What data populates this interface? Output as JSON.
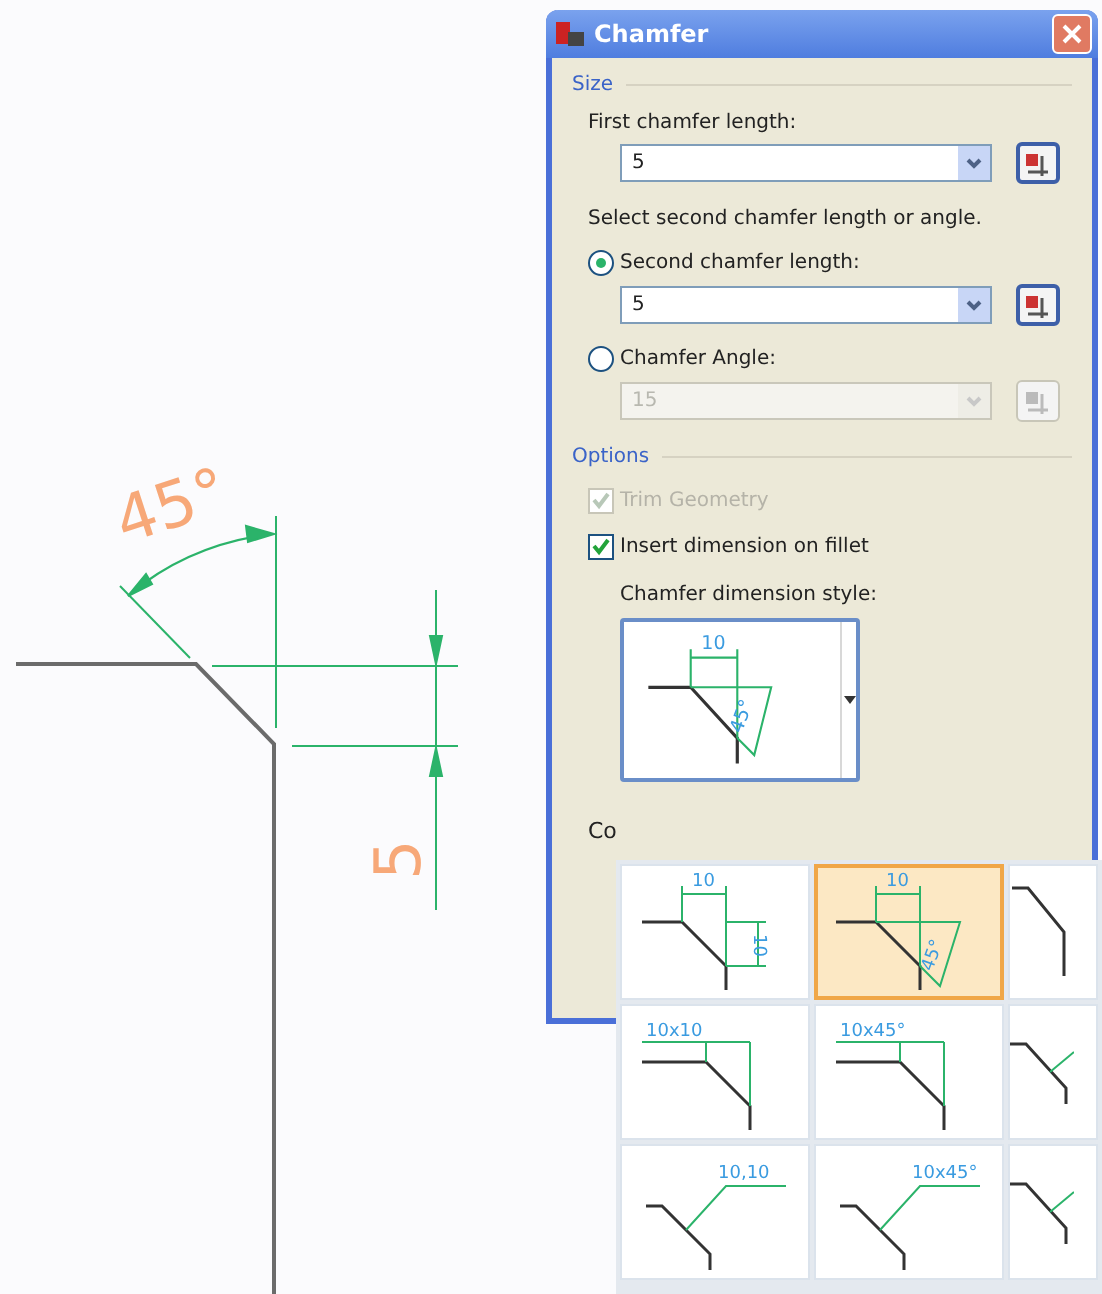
{
  "drawing": {
    "angle_label": "45°",
    "length_label": "5"
  },
  "dialog": {
    "title": "Chamfer",
    "size_group": {
      "title": "Size",
      "first_label": "First chamfer length:",
      "first_value": "5",
      "second_prompt": "Select second chamfer length or angle.",
      "modes": [
        {
          "label": "Second chamfer length:",
          "selected": true,
          "value": "5",
          "disabled": false
        },
        {
          "label": "Chamfer Angle:",
          "selected": false,
          "value": "15",
          "disabled": true
        }
      ]
    },
    "options_group": {
      "title": "Options",
      "checks": [
        {
          "label": "Trim Geometry",
          "checked": true,
          "disabled": true
        },
        {
          "label": "Insert dimension on fillet",
          "checked": true,
          "disabled": false
        }
      ],
      "style_label": "Chamfer dimension style:",
      "style_preview": {
        "kind": "aligned-angle",
        "texts": [
          "10",
          "45°"
        ]
      }
    },
    "cut_label": "Co"
  },
  "palette": {
    "cells": [
      {
        "kind": "aligned-two",
        "texts": [
          "10",
          "10"
        ],
        "selected": false
      },
      {
        "kind": "aligned-angle",
        "texts": [
          "10",
          "45°"
        ],
        "selected": true
      },
      {
        "kind": "partial-aligned",
        "selected": false
      },
      {
        "kind": "linear",
        "texts": [
          "10x10"
        ],
        "selected": false
      },
      {
        "kind": "linear",
        "texts": [
          "10x45°"
        ],
        "selected": false
      },
      {
        "kind": "partial-leader",
        "selected": false
      },
      {
        "kind": "leader",
        "texts": [
          "10,10"
        ],
        "selected": false
      },
      {
        "kind": "leader",
        "texts": [
          "10x45°"
        ],
        "selected": false
      },
      {
        "kind": "partial-leader",
        "selected": false
      }
    ]
  }
}
